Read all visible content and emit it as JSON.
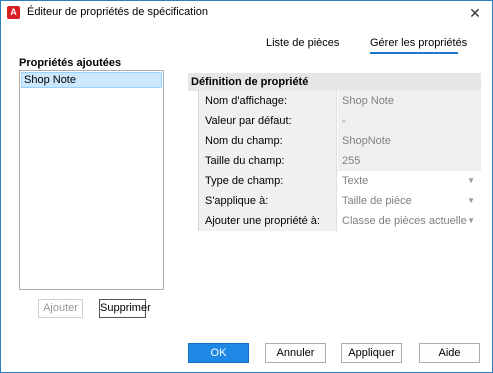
{
  "window": {
    "title": "Éditeur de propriétés de spécification",
    "app_icon": "A",
    "close_glyph": "✕"
  },
  "tabs": [
    {
      "label": "Liste de pièces",
      "selected": false
    },
    {
      "label": "Gérer les propriétés",
      "selected": true
    }
  ],
  "left_panel": {
    "title": "Propriétés ajoutées",
    "items": [
      {
        "label": "Shop Note",
        "selected": true
      }
    ],
    "add_label": "Ajouter",
    "remove_label": "Supprimer"
  },
  "definition": {
    "header": "Définition de propriété",
    "rows": [
      {
        "label": "Nom d'affichage:",
        "value": "Shop Note",
        "kind": "readonly"
      },
      {
        "label": "Valeur par défaut:",
        "value": "-",
        "kind": "readonly"
      },
      {
        "label": "Nom du champ:",
        "value": "ShopNote",
        "kind": "readonly"
      },
      {
        "label": "Taille du champ:",
        "value": "255",
        "kind": "readonly"
      },
      {
        "label": "Type de champ:",
        "value": "Texte",
        "kind": "dropdown"
      },
      {
        "label": "S'applique à:",
        "value": "Taille de pièce",
        "kind": "dropdown"
      },
      {
        "label": "Ajouter une propriété à:",
        "value": "Classe de pièces actuelle",
        "kind": "dropdown"
      }
    ],
    "dropdown_glyph": "▼"
  },
  "footer": {
    "ok_label": "OK",
    "cancel_label": "Annuler",
    "apply_label": "Appliquer",
    "help_label": "Aide"
  },
  "colors": {
    "accent": "#1e88e5",
    "selection": "#cce8ff",
    "app_icon": "#d81f26"
  }
}
